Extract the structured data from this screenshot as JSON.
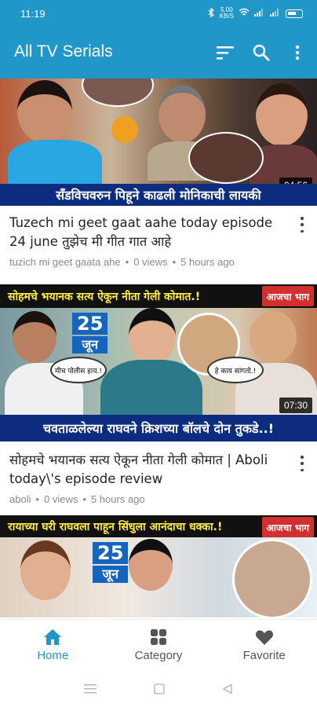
{
  "status_bar": {
    "time": "11:19",
    "speed_top": "5.00",
    "speed_bottom": "KB/S"
  },
  "app_bar": {
    "title": "All TV Serials",
    "icons": [
      "sort-icon",
      "search-icon",
      "more-vert-icon"
    ]
  },
  "videos": [
    {
      "banner": "सँडविचवरुन पिहूने काढली मोनिकाची लायकी",
      "duration": "04:56",
      "title": "Tuzech mi geet gaat aahe today episode 24 june तुझेच मी गीत गात आहे",
      "channel": "tuzich mi geet gaata ahe",
      "views": "0 views",
      "time": "5 hours ago"
    },
    {
      "top_banner": "सोहमचे भयानक सत्य ऐकून नीता गेली कोमात.!",
      "tag": "आजचा भाग",
      "date_num": "25",
      "date_month": "जून",
      "bubble_left": "मीच पोलीस हाय.!",
      "bubble_right": "हे काय सांगतो.!",
      "banner": "चवताळलेल्या राघवने क्रिशच्या बॉलचे दोन तुकडे..!",
      "duration": "07:30",
      "title": "सोहमचे भयानक सत्य ऐकून नीता गेली कोमात | Aboli today\\'s episode review",
      "channel": "aboli",
      "views": "0 views",
      "time": "5 hours ago"
    },
    {
      "top_banner": "रायाच्या घरी राघवला पाहून सिंधुला आनंदाचा धक्का.!",
      "tag": "आजचा भाग",
      "date_num": "25",
      "date_month": "जून"
    }
  ],
  "bottom_nav": [
    {
      "label": "Home",
      "icon": "home-icon",
      "active": true
    },
    {
      "label": "Category",
      "icon": "category-grid-icon",
      "active": false
    },
    {
      "label": "Favorite",
      "icon": "heart-icon",
      "active": false
    }
  ],
  "colors": {
    "primary": "#2196c9",
    "banner_blue": "#0c2c80",
    "tag_red": "#d32f2f"
  }
}
